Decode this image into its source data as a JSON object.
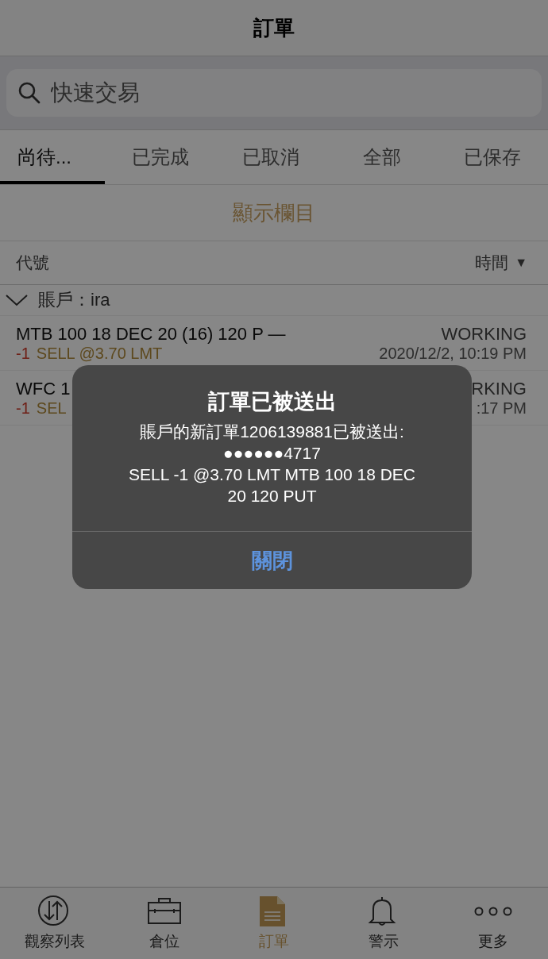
{
  "nav": {
    "title": "訂單"
  },
  "search": {
    "placeholder": "快速交易"
  },
  "tabs": [
    {
      "label": "尚待...",
      "selected": true
    },
    {
      "label": "已完成",
      "selected": false
    },
    {
      "label": "已取消",
      "selected": false
    },
    {
      "label": "全部",
      "selected": false
    },
    {
      "label": "已保存",
      "selected": false
    }
  ],
  "columns_button": "顯示欄目",
  "list_header": {
    "symbol": "代號",
    "sort": "時間",
    "sort_indicator": "▼"
  },
  "account_group": {
    "label": "賬戶：ira",
    "expanded": true,
    "orders": [
      {
        "symbol": "MTB 100 18 DEC 20 (16) 120 P —",
        "quantity": "-1",
        "action": "SELL @3.70 LMT",
        "status": "WORKING",
        "time": "2020/12/2, 10:19 PM"
      },
      {
        "symbol": "WFC 1",
        "quantity": "-1",
        "action": "SEL",
        "status": "RKING",
        "time": ":17 PM"
      }
    ]
  },
  "alert": {
    "title": "訂單已被送出",
    "message": [
      "賬戶的新訂單1206139881已被送出:",
      "●●●●●●4717",
      "SELL -1 @3.70 LMT MTB 100 18 DEC 20 120 PUT"
    ],
    "button": "關閉"
  },
  "tab_bar": [
    {
      "label": "觀察列表",
      "selected": false
    },
    {
      "label": "倉位",
      "selected": false
    },
    {
      "label": "訂單",
      "selected": true
    },
    {
      "label": "警示",
      "selected": false
    },
    {
      "label": "更多",
      "selected": false
    }
  ]
}
